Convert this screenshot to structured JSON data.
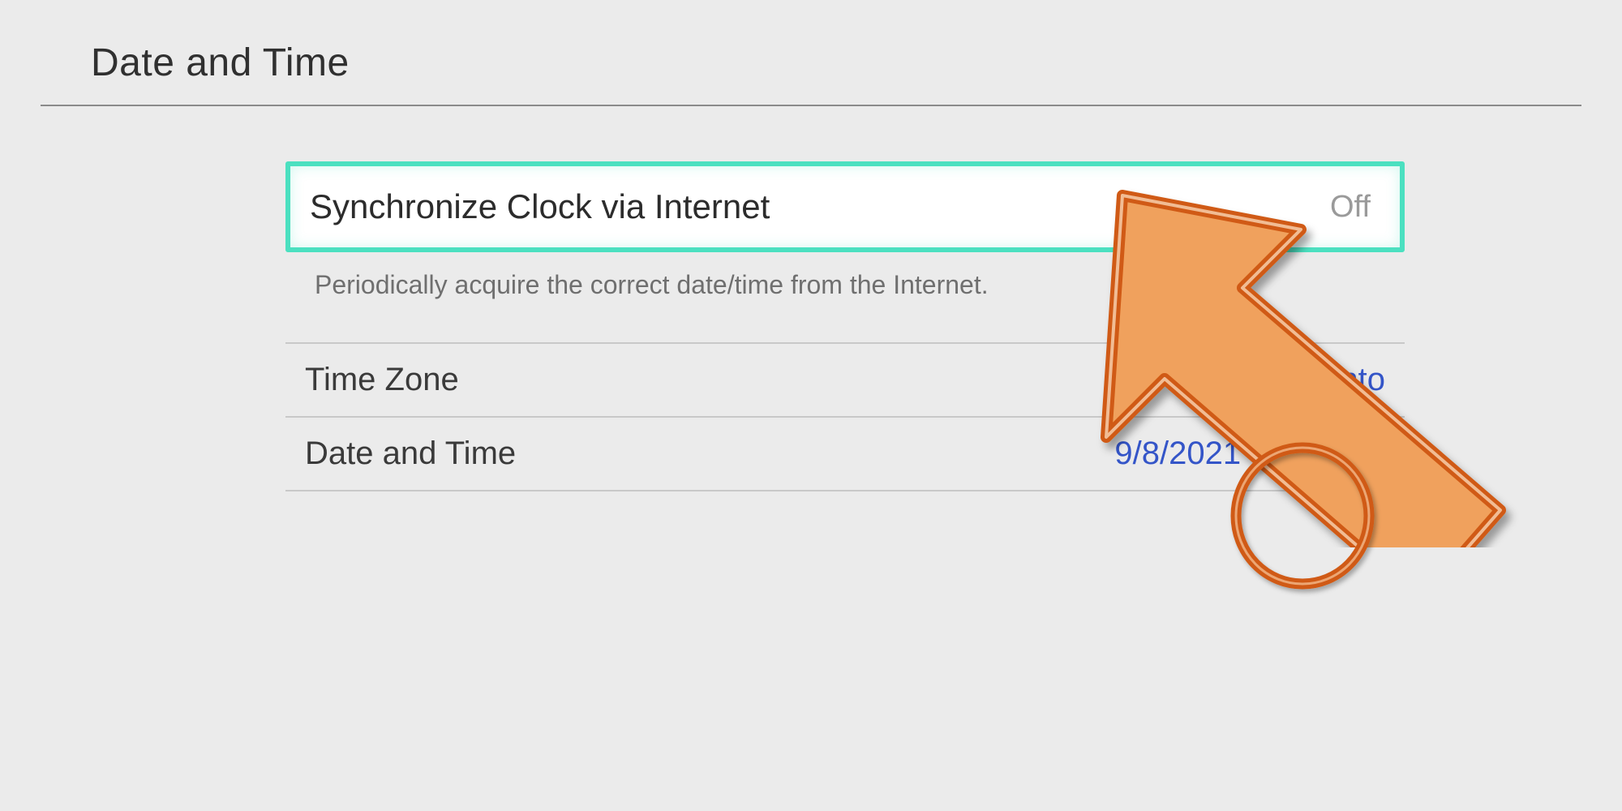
{
  "header": {
    "title": "Date and Time"
  },
  "sync": {
    "label": "Synchronize Clock via Internet",
    "value": "Off",
    "description": "Periodically acquire the correct date/time from the Internet."
  },
  "settings": {
    "timezone": {
      "label": "Time Zone",
      "value": "New York, Toronto"
    },
    "datetime": {
      "label": "Date and Time",
      "value": "9/8/2021 3:59 p.m."
    }
  },
  "annotations": {
    "arrow_color": "#df6b1e",
    "arrow_fill": "#f0a15d",
    "circle_color": "#df6b1e"
  }
}
